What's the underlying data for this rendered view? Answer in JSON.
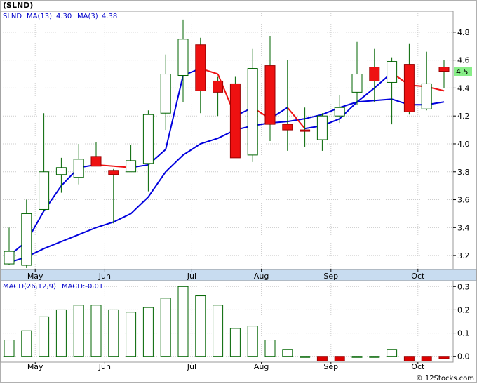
{
  "title": "(SLND)",
  "legend": {
    "symbol": "SLND",
    "ma13_label": "MA(13)",
    "ma13_value": "4.30",
    "ma3_label": "MA(3)",
    "ma3_value": "4.38",
    "macd_label": "MACD(26,12,9)",
    "macd_value_label": "MACD:-0.01"
  },
  "last_price_tag": "4.5",
  "watermark": "© 12Stocks.com",
  "colors": {
    "up_candle_fill": "#ffffff",
    "up_candle_border": "#006400",
    "down_candle_fill": "#ee1111",
    "down_candle_border": "#990000",
    "wick": "#006400",
    "ma_long": "#0000dd",
    "ma_short_up": "#0000dd",
    "ma_short_down": "#ee1111",
    "macd_pos_border": "#006400",
    "macd_neg_fill": "#dd0000",
    "grid": "#cccccc",
    "background": "#ffffff",
    "axis_band": "#c8dcf0",
    "price_tag_bg": "#88ee88"
  },
  "chart_data": [
    {
      "type": "candlestick",
      "ticker": "SLND",
      "period": "weekly",
      "grid": true,
      "y_ticks": [
        3.2,
        3.4,
        3.6,
        3.8,
        4.0,
        4.2,
        4.4,
        4.6,
        4.8
      ],
      "ylim": [
        3.1,
        4.95
      ],
      "x_tick_labels": [
        "May",
        "Jun",
        "Jul",
        "Aug",
        "Sep",
        "Oct"
      ],
      "x_tick_positions": [
        1.5,
        5.5,
        10.5,
        14.5,
        18.5,
        23.5
      ],
      "candles": [
        {
          "open": 3.14,
          "close": 3.23,
          "high": 3.4,
          "low": 3.13
        },
        {
          "open": 3.13,
          "close": 3.5,
          "high": 3.6,
          "low": 3.11
        },
        {
          "open": 3.53,
          "close": 3.8,
          "high": 4.22,
          "low": 3.52
        },
        {
          "open": 3.78,
          "close": 3.83,
          "high": 3.9,
          "low": 3.65
        },
        {
          "open": 3.76,
          "close": 3.89,
          "high": 4.0,
          "low": 3.71
        },
        {
          "open": 3.91,
          "close": 3.84,
          "high": 4.01,
          "low": 3.84
        },
        {
          "open": 3.81,
          "close": 3.78,
          "high": 3.82,
          "low": 3.43
        },
        {
          "open": 3.8,
          "close": 3.88,
          "high": 3.99,
          "low": 3.8
        },
        {
          "open": 3.86,
          "close": 4.21,
          "high": 4.24,
          "low": 3.66
        },
        {
          "open": 4.22,
          "close": 4.5,
          "high": 4.64,
          "low": 4.1
        },
        {
          "open": 4.49,
          "close": 4.75,
          "high": 4.89,
          "low": 4.3
        },
        {
          "open": 4.71,
          "close": 4.38,
          "high": 4.76,
          "low": 4.22
        },
        {
          "open": 4.45,
          "close": 4.37,
          "high": 4.48,
          "low": 4.2
        },
        {
          "open": 4.43,
          "close": 3.9,
          "high": 4.48,
          "low": 3.9
        },
        {
          "open": 3.92,
          "close": 4.54,
          "high": 4.68,
          "low": 3.87
        },
        {
          "open": 4.56,
          "close": 4.14,
          "high": 4.77,
          "low": 4.02
        },
        {
          "open": 4.14,
          "close": 4.1,
          "high": 4.6,
          "low": 3.95
        },
        {
          "open": 4.1,
          "close": 4.09,
          "high": 4.26,
          "low": 3.98
        },
        {
          "open": 4.03,
          "close": 4.2,
          "high": 4.22,
          "low": 3.95
        },
        {
          "open": 4.2,
          "close": 4.26,
          "high": 4.35,
          "low": 4.15
        },
        {
          "open": 4.37,
          "close": 4.5,
          "high": 4.73,
          "low": 4.28
        },
        {
          "open": 4.55,
          "close": 4.45,
          "high": 4.68,
          "low": 4.3
        },
        {
          "open": 4.44,
          "close": 4.59,
          "high": 4.62,
          "low": 4.14
        },
        {
          "open": 4.57,
          "close": 4.23,
          "high": 4.72,
          "low": 4.21
        },
        {
          "open": 4.25,
          "close": 4.43,
          "high": 4.66,
          "low": 4.24
        },
        {
          "open": 4.55,
          "close": 4.52,
          "high": 4.6,
          "low": 4.4
        }
      ],
      "ma_long": {
        "name": "MA(13)",
        "values": [
          3.15,
          3.19,
          3.25,
          3.3,
          3.35,
          3.4,
          3.44,
          3.5,
          3.62,
          3.8,
          3.92,
          4.0,
          4.04,
          4.1,
          4.13,
          4.15,
          4.16,
          4.18,
          4.21,
          4.26,
          4.3,
          4.31,
          4.32,
          4.28,
          4.28,
          4.3
        ]
      },
      "ma_short": {
        "name": "MA(3)",
        "values": [
          3.2,
          3.3,
          3.52,
          3.7,
          3.83,
          3.85,
          3.84,
          3.83,
          3.85,
          3.96,
          4.49,
          4.54,
          4.5,
          4.2,
          4.26,
          4.18,
          4.26,
          4.11,
          4.13,
          4.18,
          4.3,
          4.4,
          4.51,
          4.42,
          4.41,
          4.38
        ]
      }
    },
    {
      "type": "bar",
      "name": "MACD(26,12,9)",
      "grid": true,
      "y_ticks": [
        0.0,
        0.1,
        0.2,
        0.3
      ],
      "ylim": [
        -0.025,
        0.325
      ],
      "x_tick_labels": [
        "May",
        "Jun",
        "Jul",
        "Aug",
        "Sep",
        "Oct"
      ],
      "values": [
        0.07,
        0.11,
        0.17,
        0.2,
        0.22,
        0.22,
        0.2,
        0.19,
        0.21,
        0.25,
        0.3,
        0.26,
        0.22,
        0.12,
        0.13,
        0.07,
        0.03,
        0.0,
        -0.02,
        -0.02,
        0.0,
        0.0,
        0.03,
        -0.02,
        -0.02,
        -0.01
      ]
    }
  ]
}
